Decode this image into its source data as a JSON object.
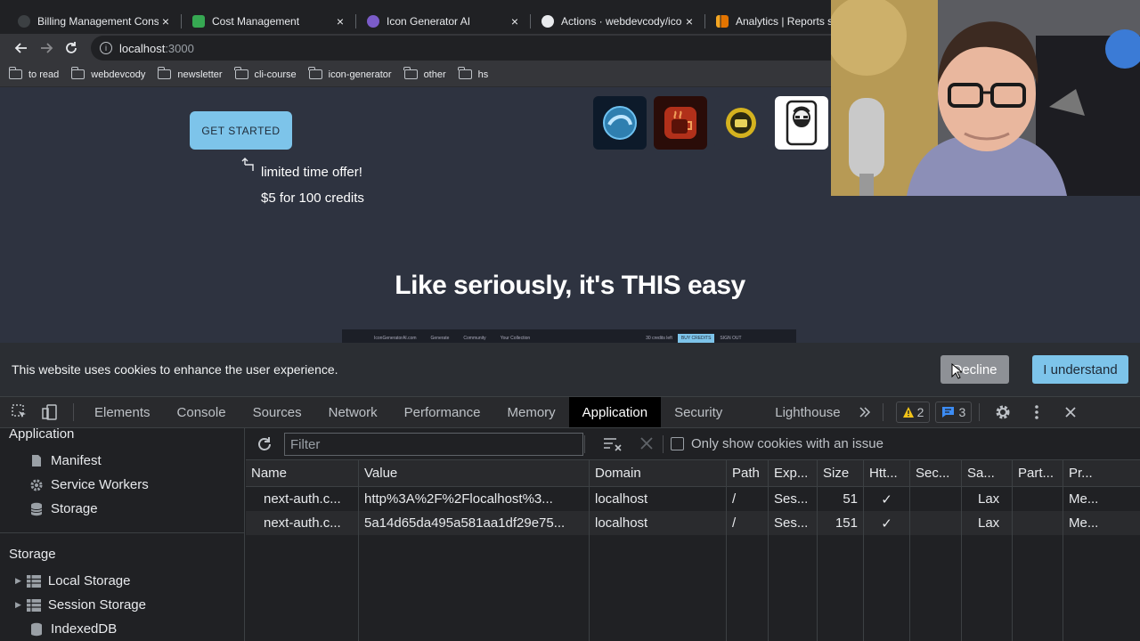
{
  "browser": {
    "tabs": [
      {
        "title": "Billing Management Consol",
        "color": "#3c4043"
      },
      {
        "title": "Cost Management",
        "color": "#36a852"
      },
      {
        "title": "Icon Generator AI",
        "color": "#7b5cc9"
      },
      {
        "title": "Actions · webdevcody/icon",
        "color": "#e8eaed"
      },
      {
        "title": "Analytics | Reports snap",
        "color": "#f4a623"
      }
    ],
    "close_glyph": "×",
    "url_host": "localhost",
    "url_port": ":3000",
    "bookmarks": [
      "to read",
      "webdevcody",
      "newsletter",
      "cli-course",
      "icon-generator",
      "other",
      "hs"
    ]
  },
  "page": {
    "cta_label": "GET STARTED",
    "offer_line1": "limited time offer!",
    "offer_line2": "$5 for 100 credits",
    "headline": "Like seriously, it's THIS easy",
    "preview_nav": [
      "IconGeneratorAI.com",
      "Generate",
      "Community",
      "Your Collection",
      "30 credits left",
      "BUY CREDITS",
      "SIGN OUT"
    ]
  },
  "cookie_banner": {
    "message": "This website uses cookies to enhance the user experience.",
    "decline_label": "Decline",
    "accept_label": "I understand"
  },
  "devtools": {
    "tabs": [
      "Elements",
      "Console",
      "Sources",
      "Network",
      "Performance",
      "Memory",
      "Application",
      "Security",
      "Lighthouse"
    ],
    "active_tab": "Application",
    "warnings_count": "2",
    "messages_count": "3",
    "sidebar": {
      "application_header": "Application",
      "application_items": [
        "Manifest",
        "Service Workers",
        "Storage"
      ],
      "storage_header": "Storage",
      "storage_items": [
        "Local Storage",
        "Session Storage",
        "IndexedDB"
      ]
    },
    "filter_placeholder": "Filter",
    "issue_checkbox_label": "Only show cookies with an issue",
    "columns": [
      "Name",
      "Value",
      "Domain",
      "Path",
      "Exp...",
      "Size",
      "Htt...",
      "Sec...",
      "Sa...",
      "Part...",
      "Pr..."
    ],
    "rows": [
      [
        "next-auth.c...",
        "http%3A%2F%2Flocalhost%3...",
        "localhost",
        "/",
        "Ses...",
        "51",
        "✓",
        "",
        "Lax",
        "",
        "Me..."
      ],
      [
        "next-auth.c...",
        "5a14d65da495a581aa1df29e75...",
        "localhost",
        "/",
        "Ses...",
        "151",
        "✓",
        "",
        "Lax",
        "",
        "Me..."
      ]
    ]
  }
}
